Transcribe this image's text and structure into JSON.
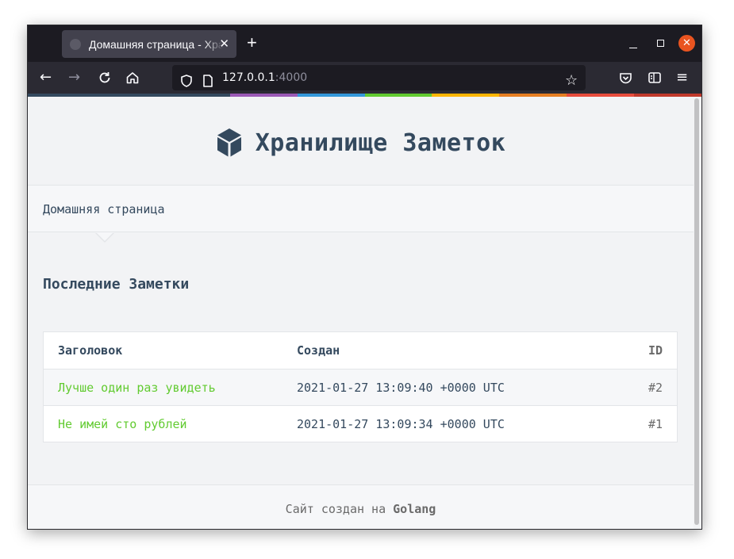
{
  "browser": {
    "tab_title": "Домашняя страница - Хранилище Заметок",
    "tab_close": "✕",
    "new_tab": "+",
    "url_host": "127.0.0.1",
    "url_port": ":4000"
  },
  "rainbow_colors": [
    "#34495e",
    "#34495e",
    "#34495e",
    "#9b59b6",
    "#3498db",
    "#62cb31",
    "#ffb606",
    "#e67e22",
    "#e74c3c",
    "#c0392b"
  ],
  "site": {
    "title": "Хранилище Заметок",
    "nav_home": "Домашняя страница"
  },
  "main": {
    "section_title": "Последние Заметки",
    "table": {
      "headers": {
        "title": "Заголовок",
        "created": "Создан",
        "id": "ID"
      },
      "rows": [
        {
          "title": "Лучше один раз увидеть",
          "created": "2021-01-27 13:09:40 +0000 UTC",
          "id": "#2"
        },
        {
          "title": "Не имей сто рублей",
          "created": "2021-01-27 13:09:34 +0000 UTC",
          "id": "#1"
        }
      ]
    }
  },
  "footer": {
    "prefix": "Сайт создан на ",
    "brand": "Golang"
  },
  "colors": {
    "primary_text": "#34495e",
    "link_green": "#62cb31",
    "close_button": "#e95420"
  },
  "icons": [
    "cube-icon",
    "back-arrow-icon",
    "forward-arrow-icon",
    "reload-icon",
    "home-icon",
    "shield-icon",
    "page-icon",
    "star-icon",
    "pocket-icon",
    "reader-icon",
    "menu-icon"
  ]
}
